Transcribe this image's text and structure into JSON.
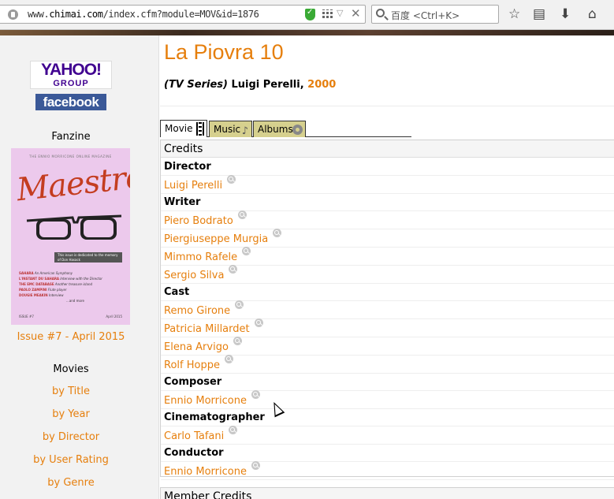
{
  "browser": {
    "url_prefix": "www.",
    "url_domain": "chimai.com",
    "url_path": "/index.cfm?module=MOV&id=1876",
    "search_placeholder": "百度 <Ctrl+K>"
  },
  "sidebar": {
    "yahoo_line1": "YAHOO!",
    "yahoo_line2": "GROUP",
    "facebook": "facebook",
    "fanzine_label": "Fanzine",
    "cover": {
      "header": "THE ENNIO MORRICONE ONLINE MAGAZINE",
      "title": "Maestro",
      "dedication": "This issue is dedicated to the memory of Don Hasack",
      "items": [
        {
          "name": "SAHARA",
          "desc": "An American Symphony"
        },
        {
          "name": "L'INSTANT DU SAHARA",
          "desc": "Interview with the Director"
        },
        {
          "name": "THE EMC DATABASE",
          "desc": "Another treasure island"
        },
        {
          "name": "PAOLO ZAMPINI",
          "desc": "Flute player"
        },
        {
          "name": "DOUGIE MEAKIN",
          "desc": "Interview"
        }
      ],
      "more": "...and more",
      "issue": "ISSUE #7",
      "date": "April 2015"
    },
    "issue_link": "Issue #7 - April 2015",
    "movies_heading": "Movies",
    "links": [
      "by Title",
      "by Year",
      "by Director",
      "by User Rating",
      "by Genre"
    ]
  },
  "main": {
    "title": "La Piovra 10",
    "subtitle_type": "(TV Series)",
    "subtitle_director": " Luigi Perelli, ",
    "subtitle_year": "2000",
    "tabs": {
      "movie": "Movie",
      "music": "Music",
      "albums": "Albums"
    },
    "credits_heading": "Credits",
    "credits": [
      {
        "role": "Director",
        "people": [
          "Luigi Perelli"
        ]
      },
      {
        "role": "Writer",
        "people": [
          "Piero Bodrato",
          "Piergiuseppe Murgia",
          "Mimmo Rafele",
          "Sergio Silva"
        ]
      },
      {
        "role": "Cast",
        "people": [
          "Remo Girone",
          "Patricia Millardet",
          "Elena Arvigo",
          "Rolf Hoppe"
        ]
      },
      {
        "role": "Composer",
        "people": [
          "Ennio Morricone"
        ]
      },
      {
        "role": "Cinematographer",
        "people": [
          "Carlo Tafani"
        ]
      },
      {
        "role": "Conductor",
        "people": [
          "Ennio Morricone"
        ]
      }
    ],
    "member_credits_heading": "Member Credits"
  },
  "colors": {
    "accent": "#e67f0d",
    "tab_bg": "#d6d08e",
    "sidebar_bg": "#f2f2f2",
    "facebook": "#3b5998",
    "yahoo": "#400090"
  },
  "icons": [
    "globe-icon",
    "shield-icon",
    "qr-icon",
    "dropdown-icon",
    "close-icon",
    "search-icon",
    "star-icon",
    "reader-icon",
    "download-icon",
    "home-icon",
    "film-icon",
    "music-note-icon",
    "disc-icon",
    "magnify-icon"
  ]
}
